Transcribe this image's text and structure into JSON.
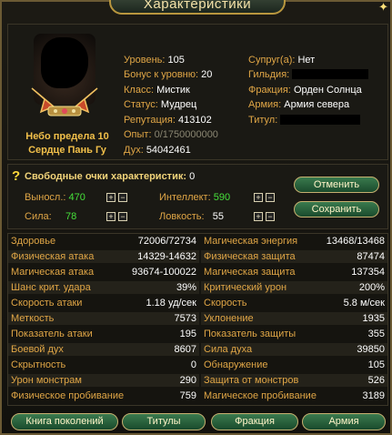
{
  "window": {
    "title": "Характеристики"
  },
  "hero": {
    "title": "Небо предела 10",
    "name": "Сердце Пань Гу"
  },
  "info_left": [
    {
      "label": "Уровень:",
      "value": "105"
    },
    {
      "label": "Бонус к уровню:",
      "value": "20"
    },
    {
      "label": "Класс:",
      "value": "Мистик"
    },
    {
      "label": "Статус:",
      "value": "Мудрец"
    },
    {
      "label": "Репутация:",
      "value": "413102"
    },
    {
      "label": "Опыт:",
      "value": "0/1750000000"
    },
    {
      "label": "Дух:",
      "value": "54042461"
    }
  ],
  "info_right": [
    {
      "label": "Супруг(а):",
      "value": "Нет"
    },
    {
      "label": "Гильдия:",
      "value": ""
    },
    {
      "label": "Фракция:",
      "value": "Орден Солнца"
    },
    {
      "label": "Армия:",
      "value": "Армия севера"
    },
    {
      "label": "Титул:",
      "value": ""
    }
  ],
  "points": {
    "title": "Свободные очки характеристик:",
    "free": "0",
    "attributes": [
      {
        "label": "Выносл.:",
        "value": "470"
      },
      {
        "label": "Интеллект:",
        "value": "590"
      },
      {
        "label": "Сила:",
        "value": "78"
      },
      {
        "label": "Ловкость:",
        "value": "55"
      }
    ],
    "plus": "+",
    "minus": "−",
    "cancel_label": "Отменить",
    "save_label": "Сохранить"
  },
  "stats_left": [
    {
      "label": "Здоровье",
      "value": "72006/72734"
    },
    {
      "label": "Физическая атака",
      "value": "14329-14632"
    },
    {
      "label": "Магическая атака",
      "value": "93674-100022"
    },
    {
      "label": "Шанс крит. удара",
      "value": "39%"
    },
    {
      "label": "Скорость атаки",
      "value": "1.18 уд/сек"
    },
    {
      "label": "Меткость",
      "value": "7573"
    },
    {
      "label": "Показатель атаки",
      "value": "195"
    },
    {
      "label": "Боевой дух",
      "value": "8607"
    },
    {
      "label": "Скрытность",
      "value": "0"
    },
    {
      "label": "Урон монстрам",
      "value": "290"
    },
    {
      "label": "Физическое пробивание",
      "value": "759"
    }
  ],
  "stats_right": [
    {
      "label": "Магическая энергия",
      "value": "13468/13468"
    },
    {
      "label": "Физическая защита",
      "value": "87474"
    },
    {
      "label": "Магическая защита",
      "value": "137354"
    },
    {
      "label": "Критический урон",
      "value": "200%"
    },
    {
      "label": "Скорость",
      "value": "5.8 м/сек"
    },
    {
      "label": "Уклонение",
      "value": "1935"
    },
    {
      "label": "Показатель защиты",
      "value": "355"
    },
    {
      "label": "Сила духа",
      "value": "39850"
    },
    {
      "label": "Обнаружение",
      "value": "105"
    },
    {
      "label": "Защита от монстров",
      "value": "526"
    },
    {
      "label": "Магическое пробивание",
      "value": "3189"
    }
  ],
  "bottom": {
    "generations_label": "Книга поколений",
    "titles_label": "Титулы",
    "faction_label": "Фракция",
    "army_label": "Армия"
  }
}
